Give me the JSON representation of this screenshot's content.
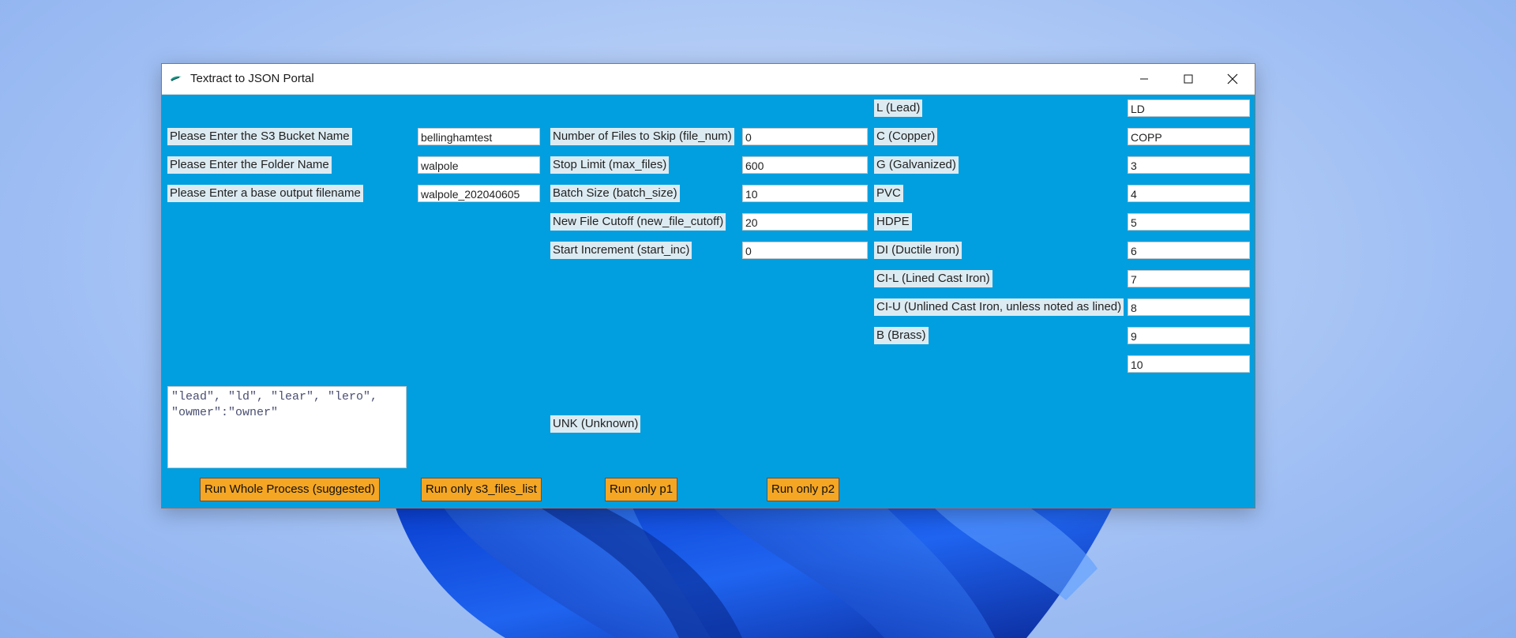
{
  "window": {
    "title": "Textract to JSON Portal"
  },
  "left_labels": [
    "Please Enter the S3 Bucket Name",
    "Please Enter the Folder Name",
    "Please Enter a base output filename"
  ],
  "left_inputs": [
    "bellinghamtest",
    "walpole",
    "walpole_202040605"
  ],
  "params": [
    {
      "label": "Number of Files to Skip (file_num)",
      "value": "0"
    },
    {
      "label": "Stop Limit (max_files)",
      "value": "600"
    },
    {
      "label": "Batch Size (batch_size)",
      "value": "10"
    },
    {
      "label": "New File Cutoff (new_file_cutoff)",
      "value": "20"
    },
    {
      "label": "Start Increment (start_inc)",
      "value": "0"
    }
  ],
  "materials": [
    {
      "label": "L (Lead)",
      "value": "LD"
    },
    {
      "label": "C (Copper)",
      "value": "COPP"
    },
    {
      "label": "G (Galvanized)",
      "value": "3"
    },
    {
      "label": "PVC",
      "value": "4"
    },
    {
      "label": "HDPE",
      "value": "5"
    },
    {
      "label": "DI (Ductile Iron)",
      "value": "6"
    },
    {
      "label": "CI-L (Lined Cast Iron)",
      "value": "7"
    },
    {
      "label": "CI-U (Unlined Cast Iron, unless noted as lined)",
      "value": "8"
    },
    {
      "label": "B (Brass)",
      "value": "9"
    },
    {
      "label": "",
      "value": "10"
    }
  ],
  "unknown_label": "UNK (Unknown)",
  "keywords_text": "\"lead\", \"ld\", \"lear\", \"lero\",\n\"owmer\":\"owner\"",
  "buttons": {
    "whole": "Run Whole Process (suggested)",
    "s3": "Run only s3_files_list",
    "p1": "Run only p1",
    "p2": "Run only p2"
  },
  "colors": {
    "window_bg": "#019fdf",
    "button_bg": "#f5a623",
    "label_bg": "#dcebf2"
  }
}
